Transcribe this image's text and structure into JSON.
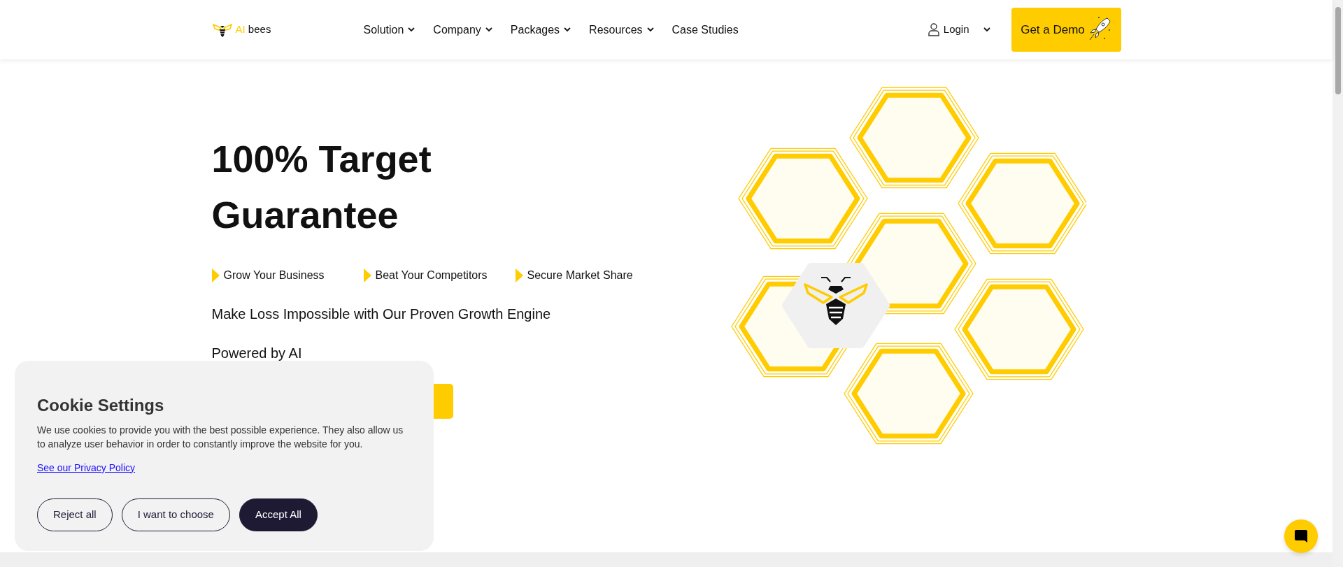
{
  "logo": {
    "accent": "AI",
    "text": "bees"
  },
  "nav": [
    {
      "label": "Solution",
      "dropdown": true
    },
    {
      "label": "Company",
      "dropdown": true
    },
    {
      "label": "Packages",
      "dropdown": true
    },
    {
      "label": "Resources",
      "dropdown": true
    },
    {
      "label": "Case Studies",
      "dropdown": false
    }
  ],
  "login": {
    "label": "Login",
    "dropdown": true
  },
  "demo_button": {
    "label": "Get a Demo"
  },
  "hero": {
    "title_lines": [
      "100% Target",
      "Guarantee"
    ],
    "bullets": [
      "Grow Your Business",
      "Beat Your Competitors",
      "Secure Market Share"
    ],
    "tagline": "Make Loss Impossible with Our Proven Growth Engine",
    "subline": "Powered by AI"
  },
  "cookie": {
    "title": "Cookie Settings",
    "text": "We use cookies to provide you with the best possible experience. They also allow us to analyze user behavior in order to constantly improve the website for you.",
    "link": "See our Privacy Policy",
    "buttons": [
      {
        "label": "Reject all",
        "kind": "outline"
      },
      {
        "label": "I want to choose",
        "kind": "outline"
      },
      {
        "label": "Accept All",
        "kind": "filled"
      }
    ]
  }
}
